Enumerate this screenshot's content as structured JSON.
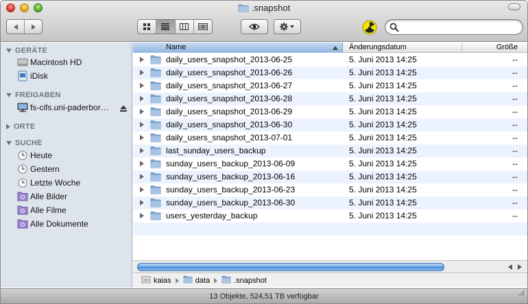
{
  "window": {
    "title": "snapshot",
    "title_prefix": "."
  },
  "toolbar": {
    "back_icon": "back-arrow-icon",
    "forward_icon": "forward-arrow-icon",
    "views": [
      "icon-view-icon",
      "list-view-icon",
      "column-view-icon",
      "coverflow-view-icon"
    ],
    "active_view": "list",
    "search": {
      "value": "",
      "placeholder": ""
    }
  },
  "sidebar": {
    "sections": [
      {
        "title": "GERÄTE",
        "expanded": true,
        "items": [
          {
            "label": "Macintosh HD",
            "icon": "harddisk-icon"
          },
          {
            "label": "iDisk",
            "icon": "idisk-icon"
          }
        ]
      },
      {
        "title": "FREIGABEN",
        "expanded": true,
        "items": [
          {
            "label": "fs-cifs.uni-paderbor…",
            "icon": "network-server-icon",
            "eject": true
          }
        ]
      },
      {
        "title": "ORTE",
        "expanded": false,
        "items": []
      },
      {
        "title": "SUCHE",
        "expanded": true,
        "items": [
          {
            "label": "Heute",
            "icon": "clock-icon"
          },
          {
            "label": "Gestern",
            "icon": "clock-icon"
          },
          {
            "label": "Letzte Woche",
            "icon": "clock-icon"
          },
          {
            "label": "Alle Bilder",
            "icon": "smart-folder-icon"
          },
          {
            "label": "Alle Filme",
            "icon": "smart-folder-icon"
          },
          {
            "label": "Alle Dokumente",
            "icon": "smart-folder-icon"
          }
        ]
      }
    ]
  },
  "list": {
    "columns": {
      "name": "Name",
      "date": "Änderungsdatum",
      "size": "Größe"
    },
    "rows": [
      {
        "name": "daily_users_snapshot_2013-06-25",
        "date": "5. Juni 2013 14:25",
        "size": "--"
      },
      {
        "name": "daily_users_snapshot_2013-06-26",
        "date": "5. Juni 2013 14:25",
        "size": "--"
      },
      {
        "name": "daily_users_snapshot_2013-06-27",
        "date": "5. Juni 2013 14:25",
        "size": "--"
      },
      {
        "name": "daily_users_snapshot_2013-06-28",
        "date": "5. Juni 2013 14:25",
        "size": "--"
      },
      {
        "name": "daily_users_snapshot_2013-06-29",
        "date": "5. Juni 2013 14:25",
        "size": "--"
      },
      {
        "name": "daily_users_snapshot_2013-06-30",
        "date": "5. Juni 2013 14:25",
        "size": "--"
      },
      {
        "name": "daily_users_snapshot_2013-07-01",
        "date": "5. Juni 2013 14:25",
        "size": "--"
      },
      {
        "name": "last_sunday_users_backup",
        "date": "5. Juni 2013 14:25",
        "size": "--"
      },
      {
        "name": "sunday_users_backup_2013-06-09",
        "date": "5. Juni 2013 14:25",
        "size": "--"
      },
      {
        "name": "sunday_users_backup_2013-06-16",
        "date": "5. Juni 2013 14:25",
        "size": "--"
      },
      {
        "name": "sunday_users_backup_2013-06-23",
        "date": "5. Juni 2013 14:25",
        "size": "--"
      },
      {
        "name": "sunday_users_backup_2013-06-30",
        "date": "5. Juni 2013 14:25",
        "size": "--"
      },
      {
        "name": "users_yesterday_backup",
        "date": "5. Juni 2013 14:25",
        "size": "--"
      }
    ]
  },
  "pathbar": [
    "kaias",
    "data",
    ".snapshot"
  ],
  "status": "13 Objekte, 524,51 TB verfügbar",
  "colors": {
    "selection_header": "#8fb4e3",
    "row_alt": "#edf3fe",
    "sidebar_bg": "#dde4eb",
    "folder": "#8cb1d9"
  }
}
